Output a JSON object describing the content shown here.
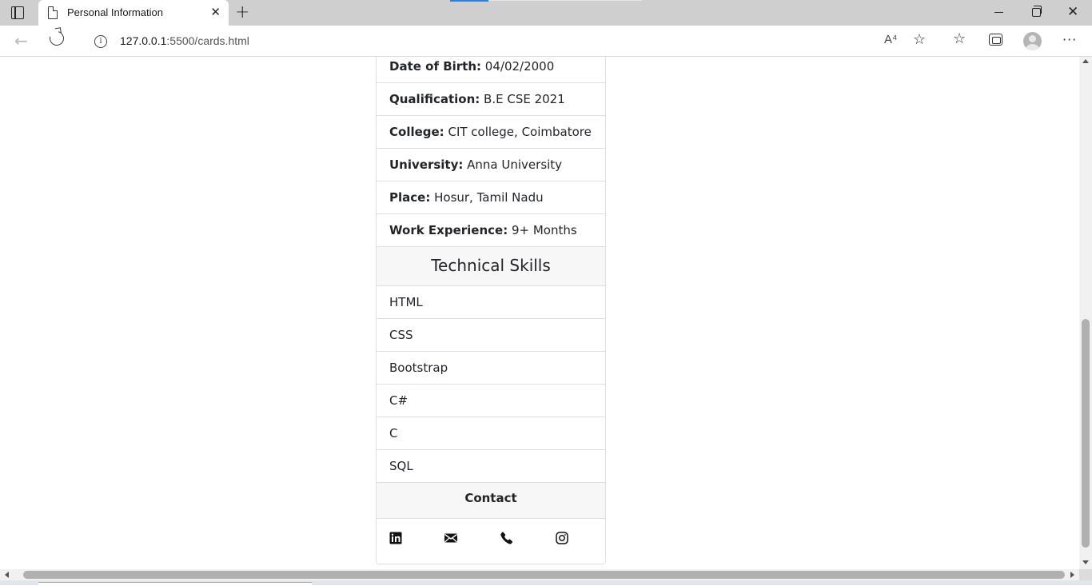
{
  "browser": {
    "tab_title": "Personal Information",
    "tab_close": "✕",
    "new_tab": "+",
    "url_host": "127.0.0.1",
    "url_rest": ":5500/cards.html",
    "read_aloud": "A⁴",
    "window_min": "",
    "window_close": "✕",
    "more": "···",
    "icons": [
      "tab-actions-icon",
      "page-icon",
      "back-icon",
      "refresh-icon",
      "info-icon",
      "read-aloud-icon",
      "add-favorite-icon",
      "favorites-icon",
      "collections-icon",
      "profile-icon",
      "more-icon"
    ]
  },
  "card": {
    "details": [
      {
        "key": "Date of Birth:",
        "value": "04/02/2000"
      },
      {
        "key": "Qualification:",
        "value": "B.E CSE 2021"
      },
      {
        "key": "College:",
        "value": "CIT college, Coimbatore"
      },
      {
        "key": "University:",
        "value": "Anna University"
      },
      {
        "key": "Place:",
        "value": "Hosur, Tamil Nadu"
      },
      {
        "key": "Work Experience:",
        "value": "9+ Months"
      }
    ],
    "skills_heading": "Technical Skills",
    "skills": [
      "HTML",
      "CSS",
      "Bootstrap",
      "C#",
      "C",
      "SQL"
    ],
    "contact_heading": "Contact",
    "contact_icons": [
      "linkedin-icon",
      "email-icon",
      "phone-icon",
      "instagram-icon"
    ]
  },
  "colors": {
    "text": "#212529",
    "border": "#dfdfdf",
    "header_bg": "#f7f7f7",
    "chrome_bg": "#cfcfcf",
    "accent": "#2f7ed8"
  }
}
